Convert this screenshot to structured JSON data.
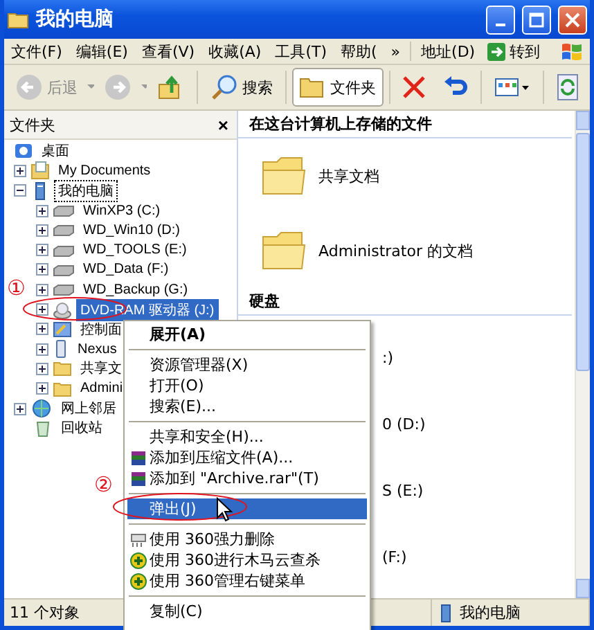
{
  "window": {
    "title": "我的电脑"
  },
  "menu_bar": {
    "items": [
      "文件(F)",
      "编辑(E)",
      "查看(V)",
      "收藏(A)",
      "工具(T)",
      "帮助("
    ],
    "more": "»",
    "address_label": "地址(D)",
    "go": "转到"
  },
  "toolbar": {
    "back": "后退",
    "search": "搜索",
    "folders": {
      "label": "文件夹",
      "selected": true
    }
  },
  "folders_pane": {
    "title": "文件夹",
    "close": "×",
    "tree": [
      {
        "label": "桌面",
        "kind": "desktop",
        "selected": false,
        "children": [
          {
            "label": "My Documents",
            "kind": "documents",
            "expanded": false,
            "selected": false
          },
          {
            "label": "我的电脑",
            "kind": "computer",
            "expanded": true,
            "selected": false,
            "children": [
              {
                "label": "WinXP3 (C:)",
                "kind": "drive",
                "expanded": false,
                "selected": false
              },
              {
                "label": "WD_Win10 (D:)",
                "kind": "drive",
                "expanded": false,
                "selected": false
              },
              {
                "label": "WD_TOOLS (E:)",
                "kind": "drive",
                "expanded": false,
                "selected": false
              },
              {
                "label": "WD_Data (F:)",
                "kind": "drive",
                "expanded": false,
                "selected": false
              },
              {
                "label": "WD_Backup (G:)",
                "kind": "drive",
                "expanded": false,
                "selected": false
              },
              {
                "label": "DVD-RAM 驱动器 (J:)",
                "kind": "cdrom",
                "expanded": false,
                "selected": true
              },
              {
                "label": "控制面",
                "kind": "control",
                "expanded": false,
                "selected": false
              },
              {
                "label": "Nexus",
                "kind": "phone",
                "expanded": false,
                "selected": false
              },
              {
                "label": "共享文",
                "kind": "folder",
                "expanded": false,
                "selected": false
              },
              {
                "label": "Admini",
                "kind": "folder",
                "expanded": false,
                "selected": false
              }
            ]
          },
          {
            "label": "网上邻居",
            "kind": "network",
            "expanded": false,
            "selected": false
          },
          {
            "label": "回收站",
            "kind": "recycle",
            "selected": false
          }
        ]
      }
    ]
  },
  "content": {
    "sections": [
      {
        "title": "在这台计算机上存储的文件",
        "items": [
          "共享文档",
          "Administrator 的文档"
        ]
      },
      {
        "title": "硬盘",
        "items": [
          ":)",
          "0 (D:)",
          "S (E:)",
          "(F:)"
        ]
      }
    ]
  },
  "context_menu": [
    {
      "kind": "plain",
      "label": "展开(A)",
      "default": true,
      "selected": false
    },
    {
      "kind": "separator"
    },
    {
      "kind": "plain",
      "label": "资源管理器(X)",
      "default": false,
      "selected": false
    },
    {
      "kind": "plain",
      "label": "打开(O)",
      "default": false,
      "selected": false
    },
    {
      "kind": "plain",
      "label": "搜索(E)...",
      "default": false,
      "selected": false
    },
    {
      "kind": "separator"
    },
    {
      "kind": "plain",
      "label": "共享和安全(H)...",
      "default": false,
      "selected": false
    },
    {
      "kind": "archive",
      "label": "添加到压缩文件(A)...",
      "default": false,
      "selected": false
    },
    {
      "kind": "archive",
      "label": "添加到 \"Archive.rar\"(T)",
      "default": false,
      "selected": false
    },
    {
      "kind": "separator"
    },
    {
      "kind": "plain",
      "label": "弹出(J)",
      "default": false,
      "selected": true
    },
    {
      "kind": "separator"
    },
    {
      "kind": "shredder",
      "label": "使用 360强力删除",
      "default": false,
      "selected": false
    },
    {
      "kind": "shield",
      "label": "使用 360进行木马云查杀",
      "default": false,
      "selected": false
    },
    {
      "kind": "shield",
      "label": "使用 360管理右键菜单",
      "default": false,
      "selected": false
    },
    {
      "kind": "separator"
    },
    {
      "kind": "plain",
      "label": "复制(C)",
      "default": false,
      "selected": false
    }
  ],
  "annotations": [
    "①",
    "②"
  ],
  "status_bar": {
    "count": "11 个对象",
    "location": "我的电脑"
  }
}
